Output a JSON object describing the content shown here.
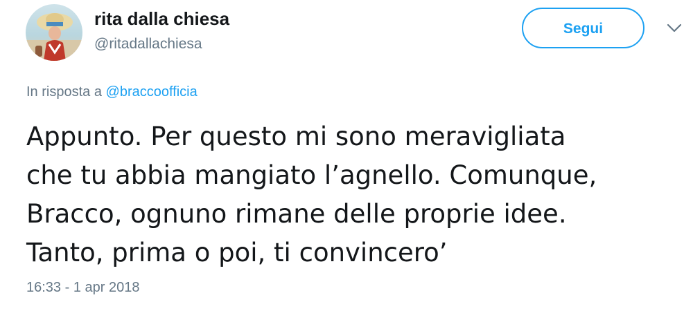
{
  "author": {
    "display_name": "rita dalla chiesa",
    "handle": "@ritadallachiesa",
    "avatar_icon": "profile-photo"
  },
  "actions": {
    "follow_label": "Segui",
    "menu_icon": "chevron-down-icon"
  },
  "reply": {
    "prefix": "In risposta a ",
    "mention": "@braccoofficia"
  },
  "tweet": {
    "lines": [
      "Appunto. Per questo mi sono meravigliata",
      "che tu abbia mangiato l’agnello. Comunque,",
      "Bracco, ognuno rimane delle proprie idee.",
      "Tanto, prima o poi, ti convincero’"
    ]
  },
  "timestamp": "16:33 - 1 apr 2018",
  "colors": {
    "accent": "#1da1f2",
    "text_primary": "#14171a",
    "text_secondary": "#657786"
  }
}
